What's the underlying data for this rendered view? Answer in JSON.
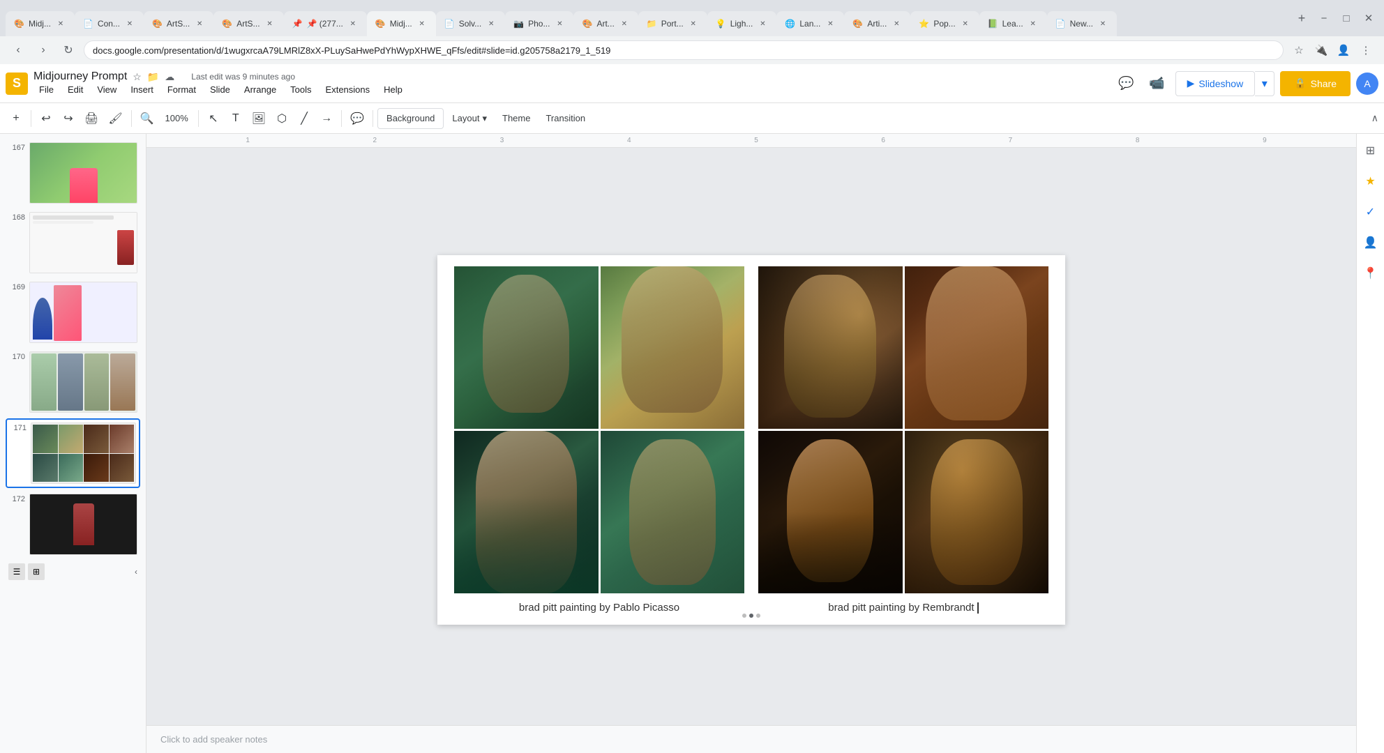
{
  "browser": {
    "tabs": [
      {
        "id": "t1",
        "label": "Midj...",
        "active": false,
        "favicon": "🎨"
      },
      {
        "id": "t2",
        "label": "Con...",
        "active": false,
        "favicon": "📄"
      },
      {
        "id": "t3",
        "label": "ArtS...",
        "active": false,
        "favicon": "🎨"
      },
      {
        "id": "t4",
        "label": "ArtS...",
        "active": false,
        "favicon": "🎨"
      },
      {
        "id": "t5",
        "label": "📌 (277...",
        "active": false,
        "favicon": "📌"
      },
      {
        "id": "t6",
        "label": "Midj...",
        "active": true,
        "favicon": "🎨"
      },
      {
        "id": "t7",
        "label": "Solv...",
        "active": false,
        "favicon": "📄"
      },
      {
        "id": "t8",
        "label": "Pho...",
        "active": false,
        "favicon": "📷"
      },
      {
        "id": "t9",
        "label": "Art...",
        "active": false,
        "favicon": "🎨"
      },
      {
        "id": "t10",
        "label": "Port...",
        "active": false,
        "favicon": "📁"
      },
      {
        "id": "t11",
        "label": "Ligh...",
        "active": false,
        "favicon": "💡"
      },
      {
        "id": "t12",
        "label": "Lan...",
        "active": false,
        "favicon": "🌐"
      },
      {
        "id": "t13",
        "label": "Arti...",
        "active": false,
        "favicon": "🎨"
      },
      {
        "id": "t14",
        "label": "Pop...",
        "active": false,
        "favicon": "⭐"
      },
      {
        "id": "t15",
        "label": "Lea...",
        "active": false,
        "favicon": "📗"
      },
      {
        "id": "t16",
        "label": "New...",
        "active": false,
        "favicon": "📄"
      }
    ],
    "address": "docs.google.com/presentation/d/1wugxrcaA79LMRlZ8xX-PLuySaHwePdYhWypXHWE_qFfs/edit#slide=id.g205758a2179_1_519"
  },
  "app": {
    "title": "Midjourney Prompt",
    "last_edit": "Last edit was 9 minutes ago"
  },
  "menu": {
    "items": [
      "File",
      "Edit",
      "View",
      "Insert",
      "Format",
      "Slide",
      "Arrange",
      "Tools",
      "Extensions",
      "Help"
    ]
  },
  "toolbar": {
    "background_label": "Background",
    "layout_label": "Layout",
    "theme_label": "Theme",
    "transition_label": "Transition"
  },
  "header_actions": {
    "slideshow_label": "Slideshow",
    "share_label": "Share"
  },
  "slides": [
    {
      "num": "167",
      "active": false
    },
    {
      "num": "168",
      "active": false
    },
    {
      "num": "169",
      "active": false
    },
    {
      "num": "170",
      "active": false
    },
    {
      "num": "171",
      "active": true
    },
    {
      "num": "172",
      "active": false
    }
  ],
  "current_slide": {
    "caption_left": "brad pitt painting by Pablo Picasso",
    "caption_right": "brad pitt painting by Rembrandt"
  },
  "speaker_notes": {
    "placeholder": "Click to add speaker notes"
  }
}
